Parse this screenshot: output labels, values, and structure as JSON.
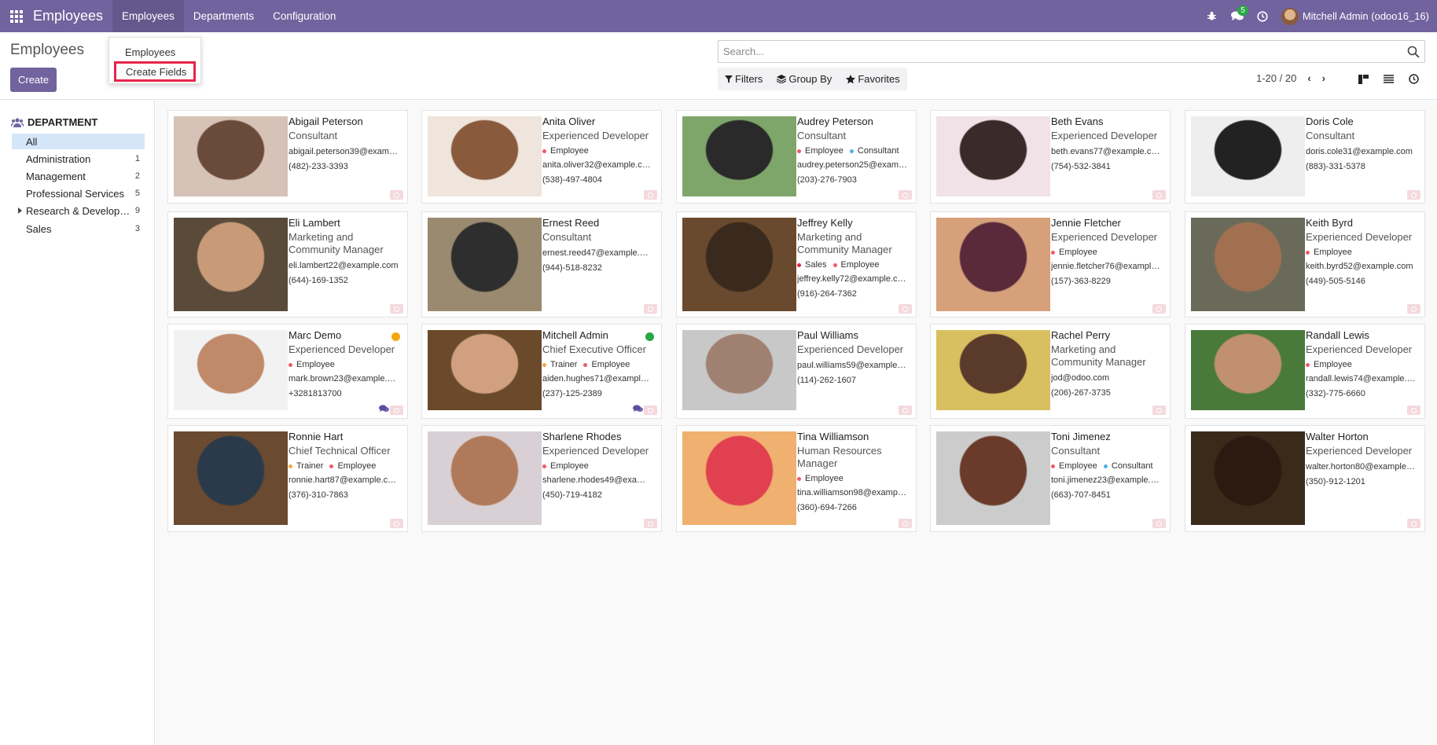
{
  "navbar": {
    "brand": "Employees",
    "menus": [
      {
        "label": "Employees",
        "active": true
      },
      {
        "label": "Departments",
        "active": false
      },
      {
        "label": "Configuration",
        "active": false
      }
    ],
    "messages_count": "5",
    "user_name": "Mitchell Admin (odoo16_16)"
  },
  "control": {
    "title": "Employees",
    "create_label": "Create",
    "search_placeholder": "Search...",
    "filters_label": "Filters",
    "groupby_label": "Group By",
    "favorites_label": "Favorites",
    "pager": "1-20 / 20"
  },
  "dropdown": {
    "items": [
      "Employees",
      "Create Fields"
    ],
    "highlight_color": "#e8244a"
  },
  "sidebar": {
    "header": "DEPARTMENT",
    "items": [
      {
        "label": "All",
        "count": ""
      },
      {
        "label": "Administration",
        "count": "1"
      },
      {
        "label": "Management",
        "count": "2"
      },
      {
        "label": "Professional Services",
        "count": "5"
      },
      {
        "label": "Research & Develop…",
        "count": "9"
      },
      {
        "label": "Sales",
        "count": "3"
      }
    ]
  },
  "colors": {
    "brand": "#71639e",
    "tag_employee": "#ef5b6b",
    "tag_consultant": "#4fb3e8",
    "tag_trainer": "#f5a44a",
    "tag_sales": "#e8244a",
    "presence_away": "#f3a712",
    "presence_online": "#28a745"
  },
  "employees": [
    {
      "name": "Abigail Peterson",
      "job": "Consultant",
      "tags": [],
      "email": "abigail.peterson39@exam…",
      "phone": "(482)-233-3393"
    },
    {
      "name": "Anita Oliver",
      "job": "Experienced Developer",
      "tags": [
        {
          "label": "Employee",
          "color": "#ef5b6b"
        }
      ],
      "email": "anita.oliver32@example.c…",
      "phone": "(538)-497-4804"
    },
    {
      "name": "Audrey Peterson",
      "job": "Consultant",
      "tags": [
        {
          "label": "Employee",
          "color": "#ef5b6b"
        },
        {
          "label": "Consultant",
          "color": "#4fb3e8"
        }
      ],
      "email": "audrey.peterson25@exam…",
      "phone": "(203)-276-7903"
    },
    {
      "name": "Beth Evans",
      "job": "Experienced Developer",
      "tags": [],
      "email": "beth.evans77@example.c…",
      "phone": "(754)-532-3841"
    },
    {
      "name": "Doris Cole",
      "job": "Consultant",
      "tags": [],
      "email": "doris.cole31@example.com",
      "phone": "(883)-331-5378"
    },
    {
      "name": "Eli Lambert",
      "job": "Marketing and Community Manager",
      "tags": [],
      "email": "eli.lambert22@example.com",
      "phone": "(644)-169-1352"
    },
    {
      "name": "Ernest Reed",
      "job": "Consultant",
      "tags": [],
      "email": "ernest.reed47@example.…",
      "phone": "(944)-518-8232"
    },
    {
      "name": "Jeffrey Kelly",
      "job": "Marketing and Community Manager",
      "tags": [
        {
          "label": "Sales",
          "color": "#e8244a"
        },
        {
          "label": "Employee",
          "color": "#ef5b6b"
        }
      ],
      "email": "jeffrey.kelly72@example.c…",
      "phone": "(916)-264-7362"
    },
    {
      "name": "Jennie Fletcher",
      "job": "Experienced Developer",
      "tags": [
        {
          "label": "Employee",
          "color": "#ef5b6b"
        }
      ],
      "email": "jennie.fletcher76@exampl…",
      "phone": "(157)-363-8229"
    },
    {
      "name": "Keith Byrd",
      "job": "Experienced Developer",
      "tags": [
        {
          "label": "Employee",
          "color": "#ef5b6b"
        }
      ],
      "email": "keith.byrd52@example.com",
      "phone": "(449)-505-5146"
    },
    {
      "name": "Marc Demo",
      "job": "Experienced Developer",
      "tags": [
        {
          "label": "Employee",
          "color": "#ef5b6b"
        }
      ],
      "email": "mark.brown23@example.…",
      "phone": "+3281813700",
      "presence": "#f3a712",
      "chat": true
    },
    {
      "name": "Mitchell Admin",
      "job": "Chief Executive Officer",
      "tags": [
        {
          "label": "Trainer",
          "color": "#f5a44a"
        },
        {
          "label": "Employee",
          "color": "#ef5b6b"
        }
      ],
      "email": "aiden.hughes71@exampl…",
      "phone": "(237)-125-2389",
      "presence": "#28a745",
      "chat": true
    },
    {
      "name": "Paul Williams",
      "job": "Experienced Developer",
      "tags": [],
      "email": "paul.williams59@example…",
      "phone": "(114)-262-1607"
    },
    {
      "name": "Rachel Perry",
      "job": "Marketing and Community Manager",
      "tags": [],
      "email": "jod@odoo.com",
      "phone": "(206)-267-3735"
    },
    {
      "name": "Randall Lewis",
      "job": "Experienced Developer",
      "tags": [
        {
          "label": "Employee",
          "color": "#ef5b6b"
        }
      ],
      "email": "randall.lewis74@example.…",
      "phone": "(332)-775-6660"
    },
    {
      "name": "Ronnie Hart",
      "job": "Chief Technical Officer",
      "tags": [
        {
          "label": "Trainer",
          "color": "#f5a44a"
        },
        {
          "label": "Employee",
          "color": "#ef5b6b"
        }
      ],
      "email": "ronnie.hart87@example.c…",
      "phone": "(376)-310-7863"
    },
    {
      "name": "Sharlene Rhodes",
      "job": "Experienced Developer",
      "tags": [
        {
          "label": "Employee",
          "color": "#ef5b6b"
        }
      ],
      "email": "sharlene.rhodes49@exa…",
      "phone": "(450)-719-4182"
    },
    {
      "name": "Tina Williamson",
      "job": "Human Resources Manager",
      "tags": [
        {
          "label": "Employee",
          "color": "#ef5b6b"
        }
      ],
      "email": "tina.williamson98@examp…",
      "phone": "(360)-694-7266"
    },
    {
      "name": "Toni Jimenez",
      "job": "Consultant",
      "tags": [
        {
          "label": "Employee",
          "color": "#ef5b6b"
        },
        {
          "label": "Consultant",
          "color": "#4fb3e8"
        }
      ],
      "email": "toni.jimenez23@example.…",
      "phone": "(663)-707-8451"
    },
    {
      "name": "Walter Horton",
      "job": "Experienced Developer",
      "tags": [],
      "email": "walter.horton80@example…",
      "phone": "(350)-912-1201"
    }
  ]
}
